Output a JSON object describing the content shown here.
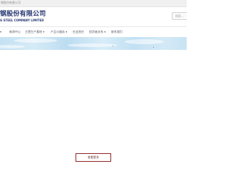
{
  "top_bar": {
    "text": "钢股份有限公司"
  },
  "header": {
    "logo_cn": "钢股份有限公司",
    "logo_en": "G STEEL COMPANY LIMITED",
    "search_placeholder": "搜索..."
  },
  "nav": {
    "items": [
      {
        "label": "▾"
      },
      {
        "label": "新闻中心"
      },
      {
        "label": "主营生产基地 ▾"
      },
      {
        "label": "产品与服务 ▾"
      },
      {
        "label": "社会责任"
      },
      {
        "label": "投资者关系 ▾"
      },
      {
        "label": "联系我们"
      }
    ]
  },
  "content": {
    "more_button_label": "查看更多"
  },
  "colors": {
    "brand": "#23356f",
    "button_border": "#8f2323",
    "banner_sky": "#c4e1f3"
  }
}
